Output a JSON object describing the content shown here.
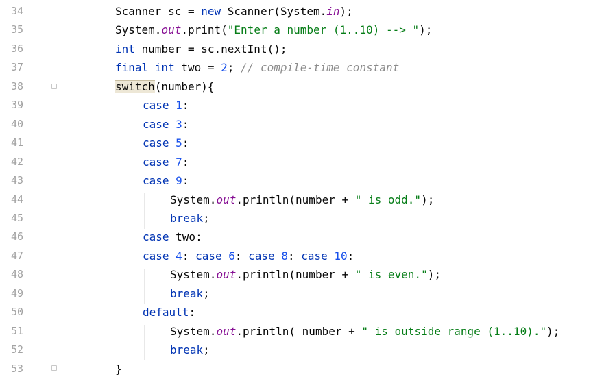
{
  "editor": {
    "lines": [
      {
        "n": "34",
        "indent": 0,
        "tokens": [
          [
            "t",
            "Scanner sc = "
          ],
          [
            "kw",
            "new"
          ],
          [
            "t",
            " Scanner(System."
          ],
          [
            "fld",
            "in"
          ],
          [
            "t",
            ");"
          ]
        ]
      },
      {
        "n": "35",
        "indent": 0,
        "tokens": [
          [
            "t",
            "System."
          ],
          [
            "fld",
            "out"
          ],
          [
            "t",
            ".print("
          ],
          [
            "str",
            "\"Enter a number (1..10) --> \""
          ],
          [
            "t",
            ");"
          ]
        ]
      },
      {
        "n": "36",
        "indent": 0,
        "tokens": [
          [
            "kw",
            "int"
          ],
          [
            "t",
            " number = sc.nextInt();"
          ]
        ]
      },
      {
        "n": "37",
        "indent": 0,
        "tokens": [
          [
            "kw",
            "final int"
          ],
          [
            "t",
            " two = "
          ],
          [
            "num",
            "2"
          ],
          [
            "t",
            "; "
          ],
          [
            "cmt",
            "// compile-time constant"
          ]
        ]
      },
      {
        "n": "38",
        "indent": 0,
        "tokens": [
          [
            "hl",
            "switch"
          ],
          [
            "t",
            "(number){"
          ]
        ]
      },
      {
        "n": "39",
        "indent": 1,
        "tokens": [
          [
            "kw",
            "case"
          ],
          [
            "t",
            " "
          ],
          [
            "num",
            "1"
          ],
          [
            "t",
            ":"
          ]
        ]
      },
      {
        "n": "40",
        "indent": 1,
        "tokens": [
          [
            "kw",
            "case"
          ],
          [
            "t",
            " "
          ],
          [
            "num",
            "3"
          ],
          [
            "t",
            ":"
          ]
        ]
      },
      {
        "n": "41",
        "indent": 1,
        "tokens": [
          [
            "kw",
            "case"
          ],
          [
            "t",
            " "
          ],
          [
            "num",
            "5"
          ],
          [
            "t",
            ":"
          ]
        ]
      },
      {
        "n": "42",
        "indent": 1,
        "tokens": [
          [
            "kw",
            "case"
          ],
          [
            "t",
            " "
          ],
          [
            "num",
            "7"
          ],
          [
            "t",
            ":"
          ]
        ]
      },
      {
        "n": "43",
        "indent": 1,
        "tokens": [
          [
            "kw",
            "case"
          ],
          [
            "t",
            " "
          ],
          [
            "num",
            "9"
          ],
          [
            "t",
            ":"
          ]
        ]
      },
      {
        "n": "44",
        "indent": 2,
        "tokens": [
          [
            "t",
            "System."
          ],
          [
            "fld",
            "out"
          ],
          [
            "t",
            ".println(number + "
          ],
          [
            "str",
            "\" is odd.\""
          ],
          [
            "t",
            ");"
          ]
        ]
      },
      {
        "n": "45",
        "indent": 2,
        "tokens": [
          [
            "kw",
            "break"
          ],
          [
            "t",
            ";"
          ]
        ]
      },
      {
        "n": "46",
        "indent": 1,
        "tokens": [
          [
            "kw",
            "case"
          ],
          [
            "t",
            " two:"
          ]
        ]
      },
      {
        "n": "47",
        "indent": 1,
        "tokens": [
          [
            "kw",
            "case"
          ],
          [
            "t",
            " "
          ],
          [
            "num",
            "4"
          ],
          [
            "t",
            ": "
          ],
          [
            "kw",
            "case"
          ],
          [
            "t",
            " "
          ],
          [
            "num",
            "6"
          ],
          [
            "t",
            ": "
          ],
          [
            "kw",
            "case"
          ],
          [
            "t",
            " "
          ],
          [
            "num",
            "8"
          ],
          [
            "t",
            ": "
          ],
          [
            "kw",
            "case"
          ],
          [
            "t",
            " "
          ],
          [
            "num",
            "10"
          ],
          [
            "t",
            ":"
          ]
        ]
      },
      {
        "n": "48",
        "indent": 2,
        "tokens": [
          [
            "t",
            "System."
          ],
          [
            "fld",
            "out"
          ],
          [
            "t",
            ".println(number + "
          ],
          [
            "str",
            "\" is even.\""
          ],
          [
            "t",
            ");"
          ]
        ]
      },
      {
        "n": "49",
        "indent": 2,
        "tokens": [
          [
            "kw",
            "break"
          ],
          [
            "t",
            ";"
          ]
        ]
      },
      {
        "n": "50",
        "indent": 1,
        "tokens": [
          [
            "kw",
            "default"
          ],
          [
            "t",
            ":"
          ]
        ]
      },
      {
        "n": "51",
        "indent": 2,
        "tokens": [
          [
            "t",
            "System."
          ],
          [
            "fld",
            "out"
          ],
          [
            "t",
            ".println( number + "
          ],
          [
            "str",
            "\" is outside range (1..10).\""
          ],
          [
            "t",
            ");"
          ]
        ]
      },
      {
        "n": "52",
        "indent": 2,
        "tokens": [
          [
            "kw",
            "break"
          ],
          [
            "t",
            ";"
          ]
        ]
      },
      {
        "n": "53",
        "indent": 0,
        "tokens": [
          [
            "t",
            "}"
          ]
        ]
      }
    ]
  },
  "colors": {
    "keyword": "#0033b3",
    "field": "#871094",
    "string": "#067d17",
    "number": "#1750eb",
    "comment": "#8c8c8c",
    "text": "#080808",
    "line_number": "#a3a3a3",
    "match_highlight": "#ede7d6"
  }
}
